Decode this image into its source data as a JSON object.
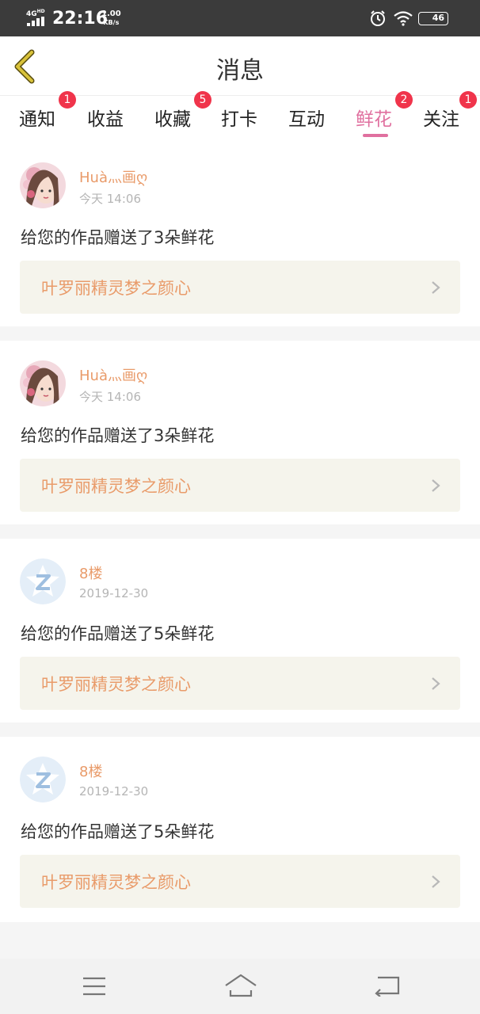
{
  "status_bar": {
    "network": "4G",
    "network_sup": "HD",
    "time": "22:16",
    "speed_value": "1.00",
    "speed_unit": "KB/s",
    "battery": "46"
  },
  "header": {
    "title": "消息",
    "back_icon": "chevron-left-icon"
  },
  "tabs": [
    {
      "label": "通知",
      "badge": "1",
      "active": false
    },
    {
      "label": "收益",
      "badge": "",
      "active": false
    },
    {
      "label": "收藏",
      "badge": "5",
      "active": false
    },
    {
      "label": "打卡",
      "badge": "",
      "active": false
    },
    {
      "label": "互动",
      "badge": "",
      "active": false
    },
    {
      "label": "鲜花",
      "badge": "2",
      "active": true
    },
    {
      "label": "关注",
      "badge": "1",
      "active": false
    }
  ],
  "messages": [
    {
      "username": "Huà灬画ღ",
      "time": "今天 14:06",
      "text": "给您的作品赠送了3朵鲜花",
      "work": "叶罗丽精灵梦之颜心",
      "avatar": "photo"
    },
    {
      "username": "Huà灬画ღ",
      "time": "今天 14:06",
      "text": "给您的作品赠送了3朵鲜花",
      "work": "叶罗丽精灵梦之颜心",
      "avatar": "photo"
    },
    {
      "username": "8楼",
      "time": "2019-12-30",
      "text": "给您的作品赠送了5朵鲜花",
      "work": "叶罗丽精灵梦之颜心",
      "avatar": "qq-default"
    },
    {
      "username": "8楼",
      "time": "2019-12-30",
      "text": "给您的作品赠送了5朵鲜花",
      "work": "叶罗丽精灵梦之颜心",
      "avatar": "qq-default"
    }
  ],
  "colors": {
    "accent": "#e0709f",
    "username": "#e99b6a",
    "badge": "#f0344b",
    "back_arrow": "#d9c23a"
  },
  "nav": {
    "menu_icon": "menu-icon",
    "home_icon": "home-icon",
    "back_icon": "return-icon"
  }
}
